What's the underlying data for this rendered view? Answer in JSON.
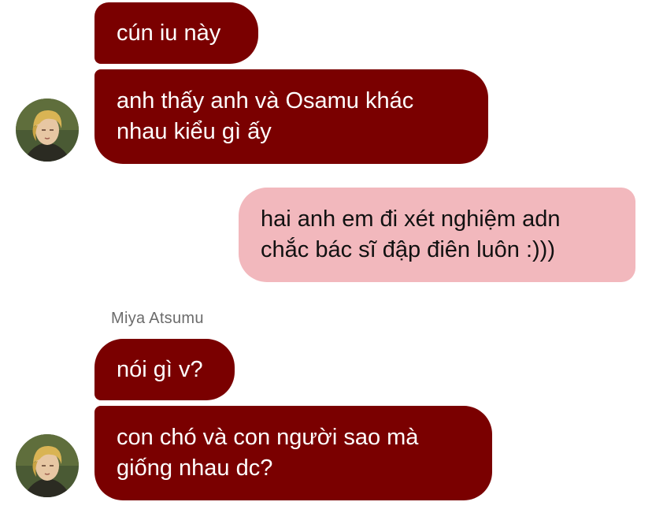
{
  "sender_name": "Miya Atsumu",
  "messages": [
    {
      "side": "incoming",
      "text": "cún iu này"
    },
    {
      "side": "incoming",
      "text": "anh thấy anh và Osamu khác\nnhau kiểu gì ấy"
    },
    {
      "side": "outgoing",
      "text": "hai anh em đi xét nghiệm adn\nchắc bác sĩ đập điên luôn :)))"
    },
    {
      "side": "incoming",
      "text": "nói gì v?"
    },
    {
      "side": "incoming",
      "text": "con chó và con người sao mà\ngiống nhau dc?"
    }
  ],
  "colors": {
    "incoming_bubble": "#7a0000",
    "outgoing_bubble": "#f2b8bd",
    "sender_name": "#6b6b6b"
  }
}
